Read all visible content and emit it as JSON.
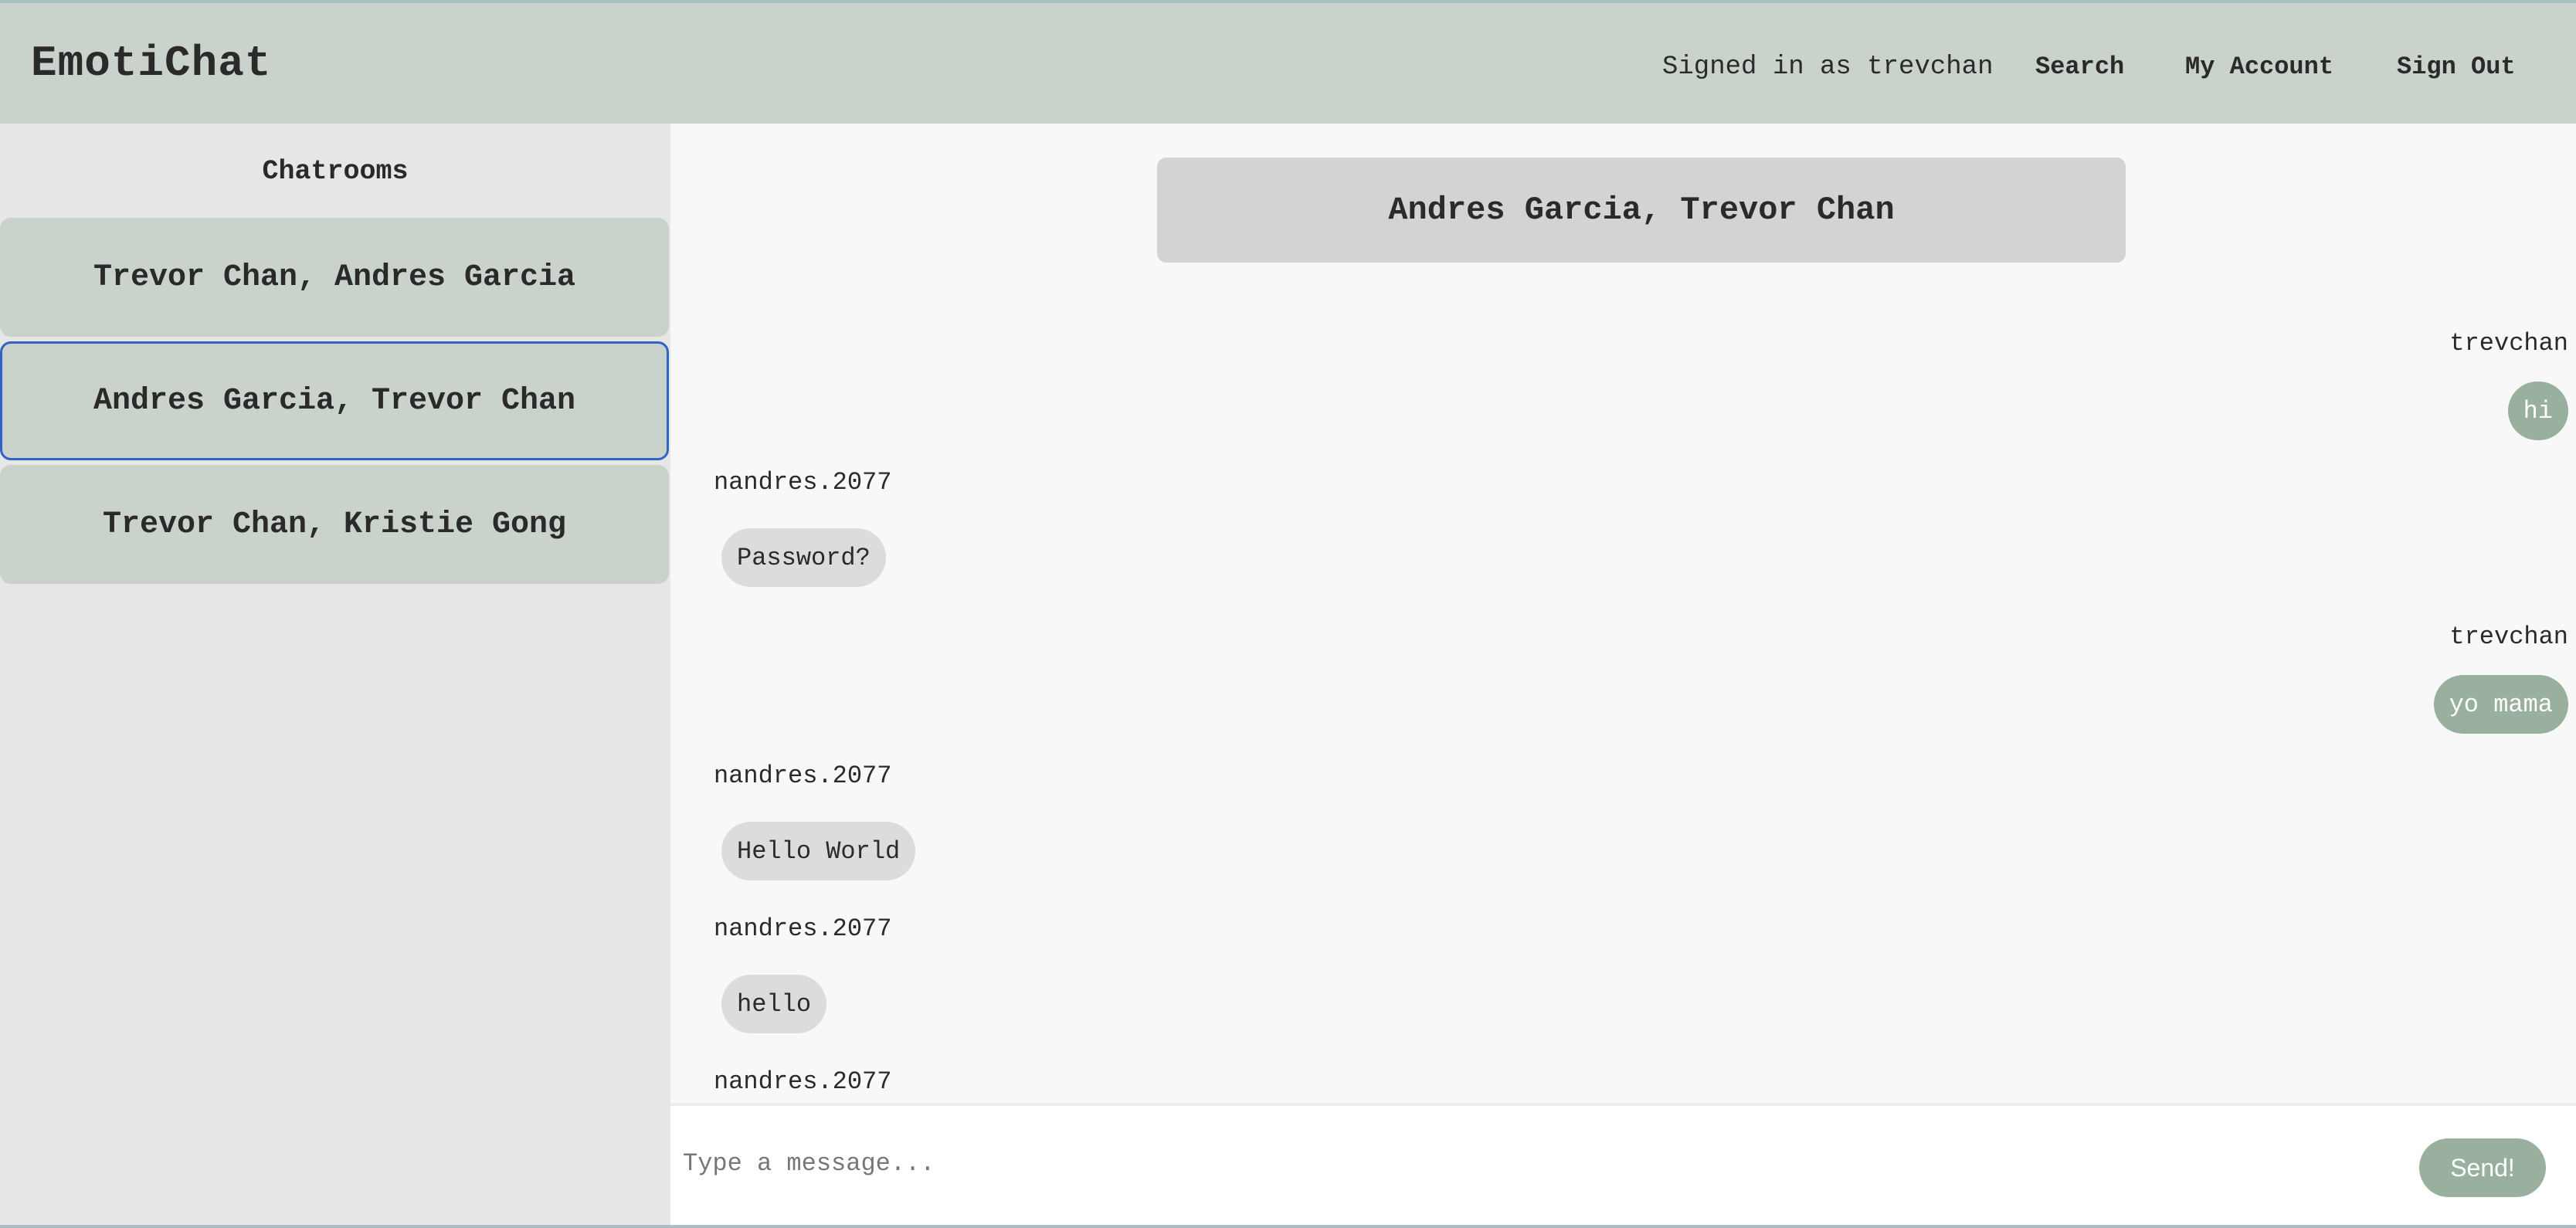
{
  "app": {
    "title": "EmotiChat"
  },
  "header": {
    "signed_in_text": "Signed in as trevchan",
    "nav": {
      "search": "Search",
      "account": "My Account",
      "sign_out": "Sign Out"
    }
  },
  "sidebar": {
    "title": "Chatrooms",
    "rooms": [
      {
        "label": "Trevor Chan, Andres Garcia"
      },
      {
        "label": "Andres Garcia, Trevor Chan",
        "selected": true
      },
      {
        "label": "Trevor Chan, Kristie Gong"
      }
    ]
  },
  "chat": {
    "room_title": "Andres Garcia, Trevor Chan",
    "messages": [
      {
        "sender": "trevchan",
        "text": "hi",
        "own": true
      },
      {
        "sender": "nandres.2077",
        "text": "Password?",
        "own": false
      },
      {
        "sender": "trevchan",
        "text": "yo mama",
        "own": true
      },
      {
        "sender": "nandres.2077",
        "text": "Hello World",
        "own": false
      },
      {
        "sender": "nandres.2077",
        "text": "hello",
        "own": false
      },
      {
        "sender": "nandres.2077",
        "text": "",
        "own": false
      }
    ]
  },
  "composer": {
    "placeholder": "Type a message...",
    "value": "",
    "send_label": "Send!"
  },
  "colors": {
    "header_bg": "#c9d2cb",
    "sidebar_bg": "#e6e6e6",
    "own_bubble": "#98b09d",
    "other_bubble": "#dcdcdc",
    "selected_border": "#2f63c8"
  }
}
